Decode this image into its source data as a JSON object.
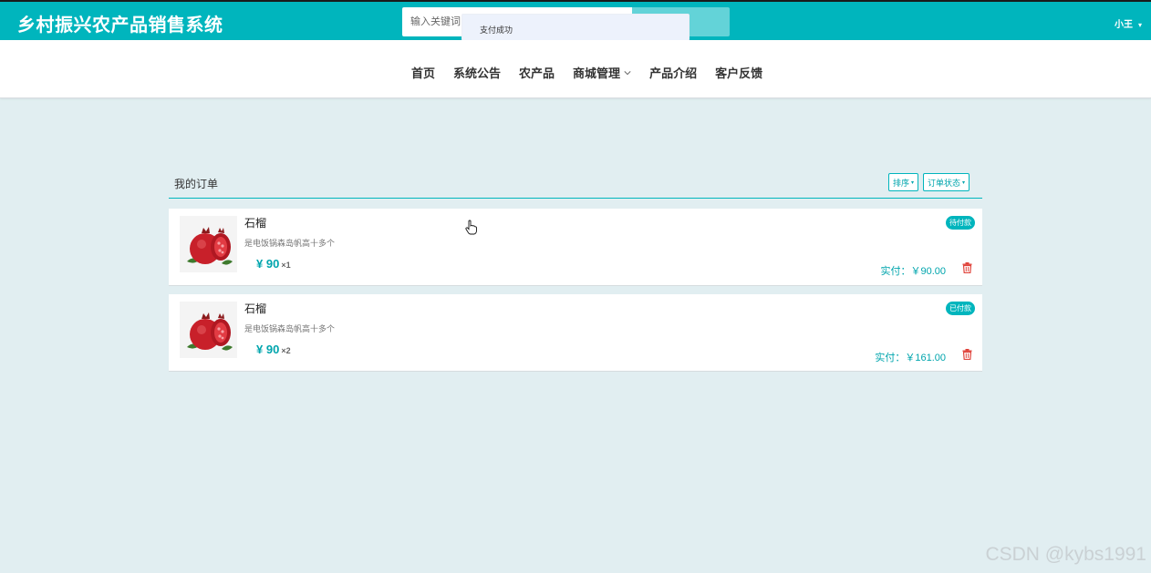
{
  "header": {
    "site_title": "乡村振兴农产品销售系统",
    "search_placeholder": "输入关键词",
    "toast_message": "支付成功",
    "user_name": "小王",
    "user_caret": "▾"
  },
  "nav": {
    "items": [
      {
        "label": "首页",
        "dropdown": false
      },
      {
        "label": "系统公告",
        "dropdown": false
      },
      {
        "label": "农产品",
        "dropdown": false
      },
      {
        "label": "商城管理",
        "dropdown": true
      },
      {
        "label": "产品介绍",
        "dropdown": false
      },
      {
        "label": "客户反馈",
        "dropdown": false
      }
    ]
  },
  "orders_panel": {
    "title": "我的订单",
    "sort_label": "排序",
    "status_filter_label": "订单状态",
    "dropdown_caret": "▾",
    "orders": [
      {
        "product_name": "石榴",
        "description": "是电饭锅森岛帆高十多个",
        "price": "¥ 90",
        "quantity": "×1",
        "status": "待付款",
        "actual_paid": "实付：￥90.00"
      },
      {
        "product_name": "石榴",
        "description": "是电饭锅森岛帆高十多个",
        "price": "¥ 90",
        "quantity": "×2",
        "status": "已付款",
        "actual_paid": "实付：￥161.00"
      }
    ]
  },
  "watermark": "CSDN @kybs1991",
  "colors": {
    "primary": "#00b5bd",
    "page_background": "#e1eef1",
    "delete_icon": "#e0443c"
  }
}
